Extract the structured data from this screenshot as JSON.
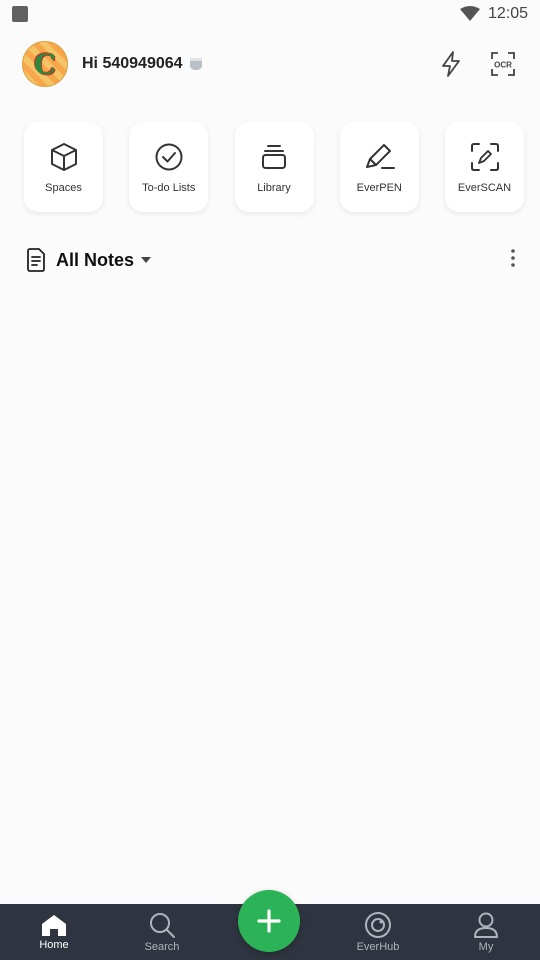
{
  "status_bar": {
    "time": "12:05"
  },
  "header": {
    "greeting": "Hi 540949064",
    "ocr_label": "OCR"
  },
  "tiles": [
    {
      "label": "Spaces",
      "icon": "cube-icon"
    },
    {
      "label": "To-do Lists",
      "icon": "check-circle-icon"
    },
    {
      "label": "Library",
      "icon": "stack-icon"
    },
    {
      "label": "EverPEN",
      "icon": "pen-icon"
    },
    {
      "label": "EverSCAN",
      "icon": "scan-icon"
    }
  ],
  "notes_section": {
    "title": "All Notes"
  },
  "bottom_nav": {
    "items": [
      {
        "label": "Home",
        "active": true
      },
      {
        "label": "Search",
        "active": false
      },
      {
        "label": "EverHub",
        "active": false
      },
      {
        "label": "My",
        "active": false
      }
    ]
  },
  "colors": {
    "accent": "#2db357",
    "nav_bg": "#2f3540",
    "background": "#fbfbfb"
  },
  "avatar": {
    "letter": "C"
  }
}
